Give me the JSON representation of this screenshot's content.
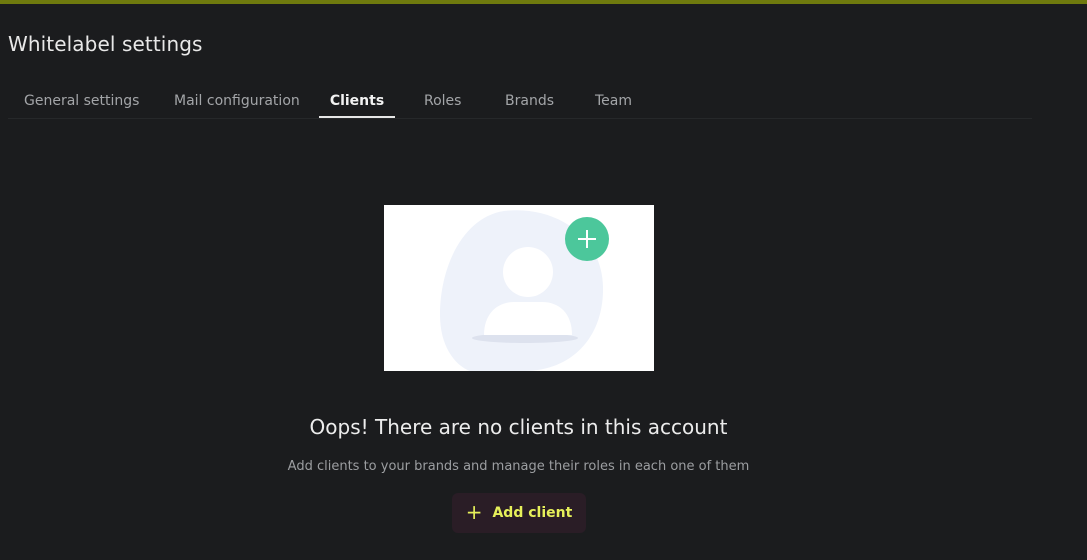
{
  "page": {
    "title": "Whitelabel settings"
  },
  "tabs": [
    {
      "label": "General settings",
      "active": false
    },
    {
      "label": "Mail configuration",
      "active": false
    },
    {
      "label": "Clients",
      "active": true
    },
    {
      "label": "Roles",
      "active": false
    },
    {
      "label": "Brands",
      "active": false
    },
    {
      "label": "Team",
      "active": false
    }
  ],
  "empty_state": {
    "illustration_icon": "add-user-icon",
    "title": "Oops! There are no clients in this account",
    "subtitle": "Add clients to your brands and manage their roles in each one of them",
    "button_icon": "plus-icon",
    "button_label": "Add client"
  },
  "colors": {
    "background": "#1b1c1e",
    "top_accent": "#6f7a0e",
    "button_text": "#e6f05a",
    "illustration_accent": "#4cc79b"
  }
}
